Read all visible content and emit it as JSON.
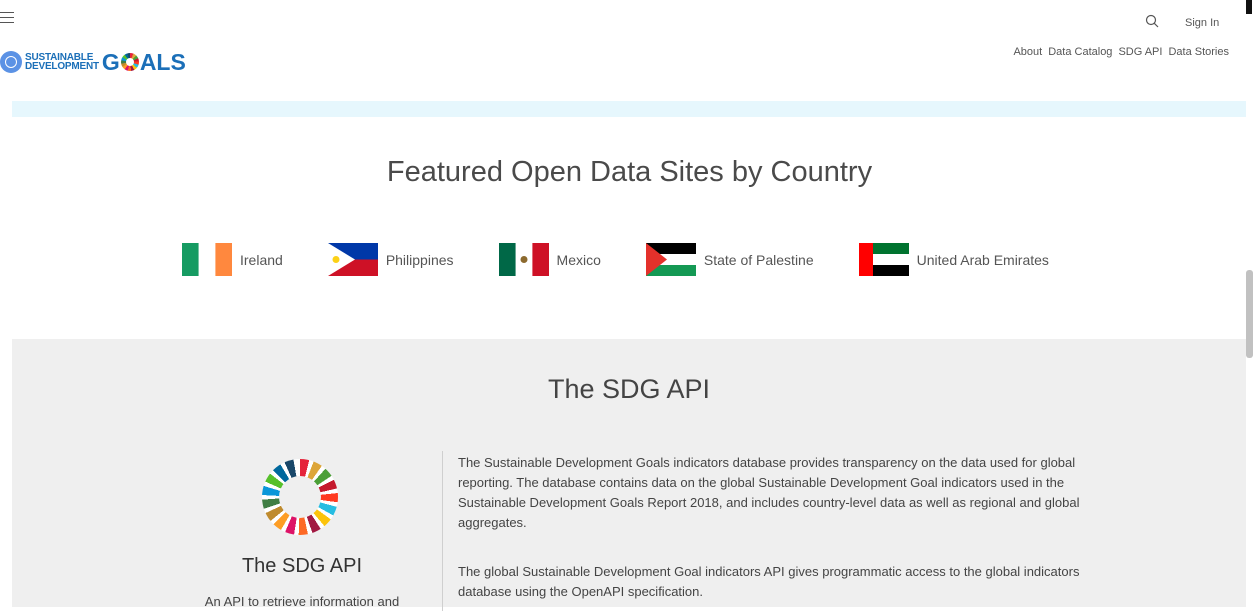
{
  "header": {
    "logo_small_line1": "SUSTAINABLE",
    "logo_small_line2": "DEVELOPMENT",
    "logo_big_pre": "G",
    "logo_big_post": "ALS",
    "sign_in": "Sign In",
    "nav": [
      "About",
      "Data Catalog",
      "SDG API",
      "Data Stories"
    ]
  },
  "featured": {
    "title": "Featured Open Data Sites by Country",
    "countries": [
      {
        "name": "Ireland",
        "flag": "ireland-flag-icon"
      },
      {
        "name": "Philippines",
        "flag": "philippines-flag-icon"
      },
      {
        "name": "Mexico",
        "flag": "mexico-flag-icon"
      },
      {
        "name": "State of Palestine",
        "flag": "palestine-flag-icon"
      },
      {
        "name": "United Arab Emirates",
        "flag": "uae-flag-icon"
      }
    ]
  },
  "api": {
    "section_title": "The SDG API",
    "card_title": "The SDG API",
    "card_desc": "An API to retrieve information and",
    "paragraph1": "The Sustainable Development Goals indicators database provides transparency on the data used for global reporting. The database contains data on the global Sustainable Development Goal indicators used in the Sustainable Development Goals Report 2018, and includes country-level data as well as regional and global aggregates.",
    "paragraph2": "The global Sustainable Development Goal indicators API gives programmatic access to the global indicators database using the OpenAPI specification."
  },
  "colors": {
    "brand_blue": "#1b6fb8",
    "banner_strip": "#e6f7fd",
    "api_background": "#efefef"
  }
}
